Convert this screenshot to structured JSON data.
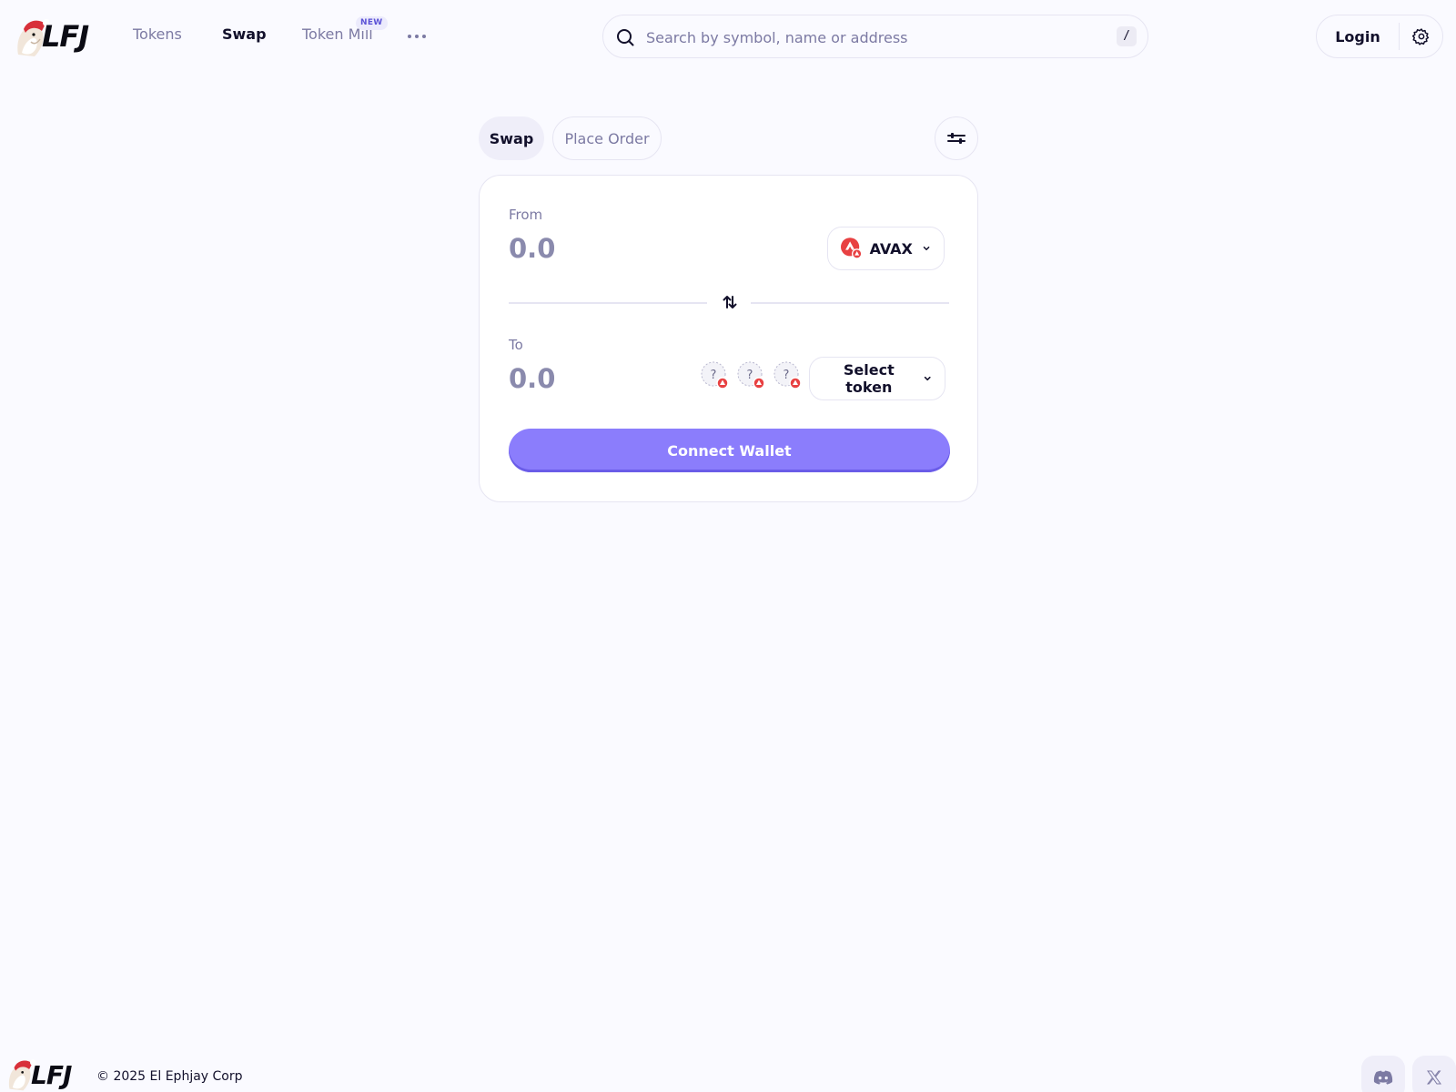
{
  "header": {
    "logo_text": "LFJ",
    "nav": [
      {
        "label": "Tokens",
        "active": false
      },
      {
        "label": "Swap",
        "active": true
      },
      {
        "label": "Token Mill",
        "active": false,
        "badge": "NEW"
      }
    ],
    "more_icon": "more-dots-icon",
    "search": {
      "placeholder": "Search by symbol, name or address",
      "value": "",
      "shortcut": "/"
    },
    "login_label": "Login",
    "settings_icon": "gear-icon"
  },
  "swap": {
    "tabs": [
      {
        "label": "Swap",
        "active": true
      },
      {
        "label": "Place Order",
        "active": false
      }
    ],
    "slippage_icon": "sliders-icon",
    "from": {
      "label": "From",
      "placeholder": "0.0",
      "value": "",
      "token": "AVAX"
    },
    "to": {
      "label": "To",
      "placeholder": "0.0",
      "value": "",
      "token_placeholder": "Select token",
      "suggested_tokens": 3
    },
    "connect_label": "Connect Wallet"
  },
  "footer": {
    "logo_text": "LFJ",
    "copyright": "© 2025 El Ephjay Corp",
    "social": [
      "discord-icon",
      "x-icon"
    ]
  },
  "colors": {
    "background": "#fafaff",
    "accent": "#8b7dfc",
    "avax_red": "#e84142",
    "muted_text": "#7c7aa3"
  }
}
